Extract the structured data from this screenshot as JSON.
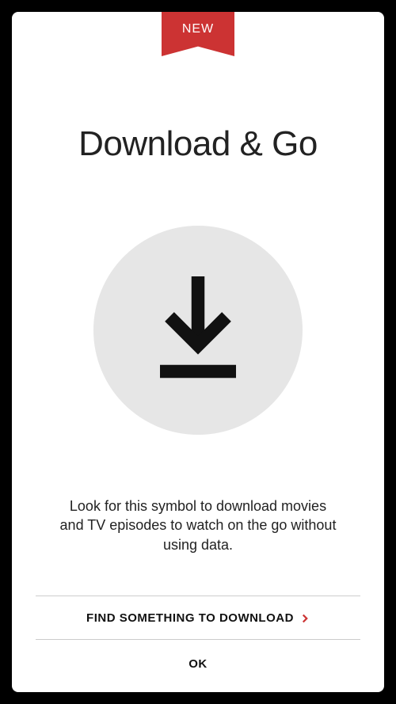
{
  "ribbon": {
    "label": "NEW"
  },
  "title": "Download & Go",
  "description": "Look for this symbol to download movies and TV episodes to watch on the go without using data.",
  "actions": {
    "find_label": "FIND SOMETHING TO DOWNLOAD",
    "ok_label": "OK"
  },
  "colors": {
    "accent": "#c33"
  }
}
